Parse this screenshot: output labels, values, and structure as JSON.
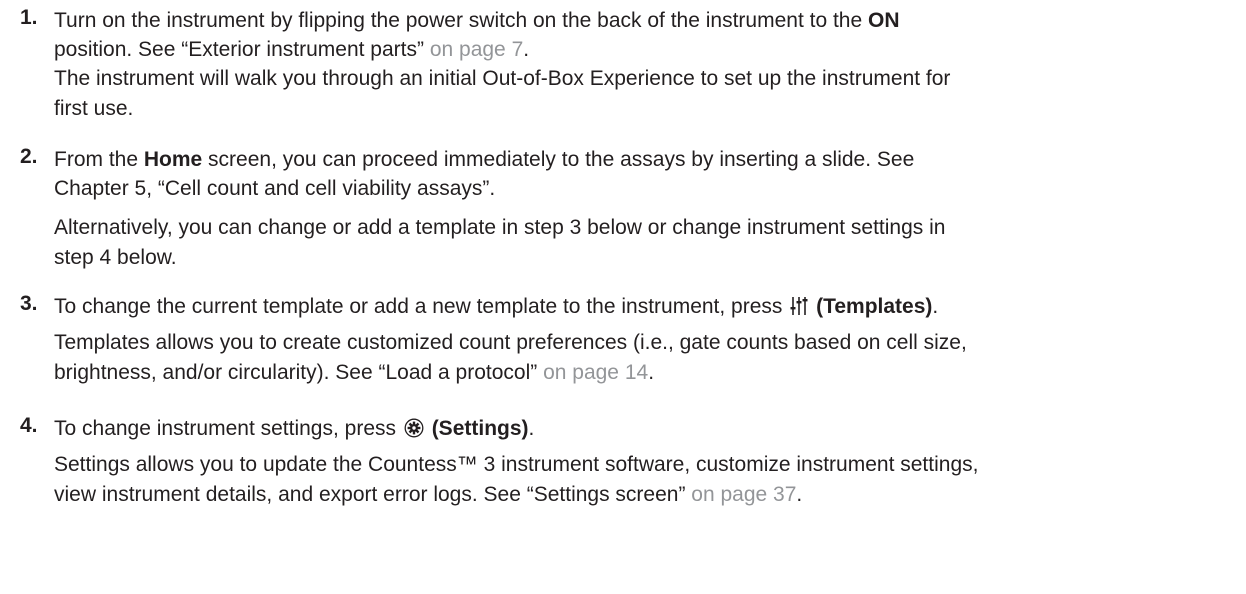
{
  "steps": [
    {
      "number": "1.",
      "lines": [
        {
          "t1": "Turn on the instrument by flipping the power switch on the back of the instrument to the ",
          "bold": "ON"
        },
        {
          "t1": "position. See “Exterior instrument parts” ",
          "link": "on page 7",
          "t2": "."
        },
        {
          "t1": "The instrument will walk you through an initial Out-of-Box Experience to set up the instrument for"
        },
        {
          "t1": "first use."
        }
      ]
    },
    {
      "number": "2.",
      "lines": [
        {
          "t1": "From the ",
          "bold": "Home",
          "t2": " screen, you can proceed immediately to the assays by inserting a slide. See"
        },
        {
          "t1": "Chapter 5, “Cell count and cell viability assays”."
        },
        {
          "t1": "Alternatively, you can change or add a template in step 3 below or change instrument settings in"
        },
        {
          "t1": "step 4 below."
        }
      ]
    },
    {
      "number": "3.",
      "lines": [
        {
          "t1": "To change the current template or add a new template to the instrument, press ",
          "icon": "templates-icon",
          "bold": "(Templates)",
          "t2": "."
        },
        {
          "t1": "Templates allows you to create customized count preferences (i.e., gate counts based on cell size,"
        },
        {
          "t1": "brightness, and/or circularity). See “Load a protocol” ",
          "link": "on page 14",
          "t2": "."
        }
      ]
    },
    {
      "number": "4.",
      "lines": [
        {
          "t1": "To change instrument settings, press ",
          "icon": "settings-gear-icon",
          "bold": "(Settings)",
          "t2": "."
        },
        {
          "t1": "Settings allows you to update the Countess™ 3 instrument software, customize instrument settings,"
        },
        {
          "t1": "view instrument details, and export error logs. See “Settings screen” ",
          "link": "on page 37",
          "t2": "."
        }
      ]
    }
  ]
}
